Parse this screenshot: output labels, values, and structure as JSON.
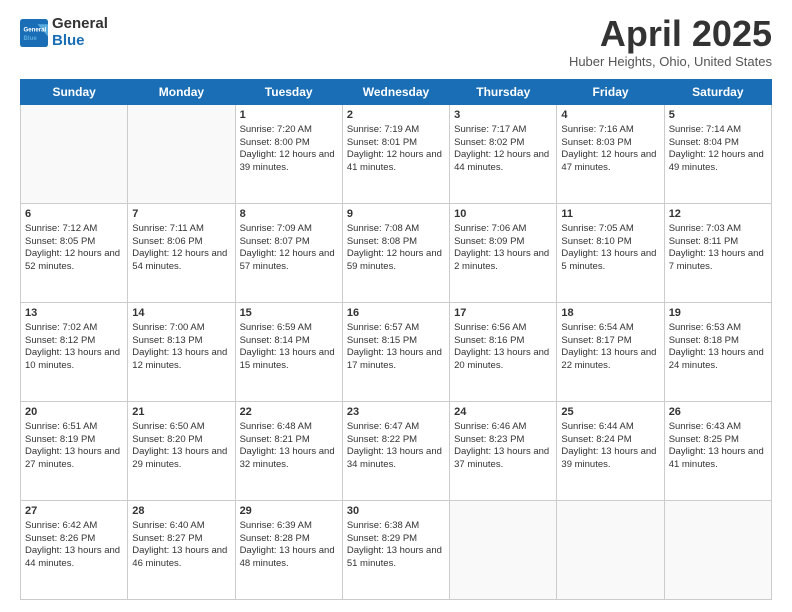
{
  "header": {
    "logo_line1": "General",
    "logo_line2": "Blue",
    "title": "April 2025",
    "location": "Huber Heights, Ohio, United States"
  },
  "weekdays": [
    "Sunday",
    "Monday",
    "Tuesday",
    "Wednesday",
    "Thursday",
    "Friday",
    "Saturday"
  ],
  "weeks": [
    [
      {
        "day": "",
        "content": ""
      },
      {
        "day": "",
        "content": ""
      },
      {
        "day": "1",
        "content": "Sunrise: 7:20 AM\nSunset: 8:00 PM\nDaylight: 12 hours and 39 minutes."
      },
      {
        "day": "2",
        "content": "Sunrise: 7:19 AM\nSunset: 8:01 PM\nDaylight: 12 hours and 41 minutes."
      },
      {
        "day": "3",
        "content": "Sunrise: 7:17 AM\nSunset: 8:02 PM\nDaylight: 12 hours and 44 minutes."
      },
      {
        "day": "4",
        "content": "Sunrise: 7:16 AM\nSunset: 8:03 PM\nDaylight: 12 hours and 47 minutes."
      },
      {
        "day": "5",
        "content": "Sunrise: 7:14 AM\nSunset: 8:04 PM\nDaylight: 12 hours and 49 minutes."
      }
    ],
    [
      {
        "day": "6",
        "content": "Sunrise: 7:12 AM\nSunset: 8:05 PM\nDaylight: 12 hours and 52 minutes."
      },
      {
        "day": "7",
        "content": "Sunrise: 7:11 AM\nSunset: 8:06 PM\nDaylight: 12 hours and 54 minutes."
      },
      {
        "day": "8",
        "content": "Sunrise: 7:09 AM\nSunset: 8:07 PM\nDaylight: 12 hours and 57 minutes."
      },
      {
        "day": "9",
        "content": "Sunrise: 7:08 AM\nSunset: 8:08 PM\nDaylight: 12 hours and 59 minutes."
      },
      {
        "day": "10",
        "content": "Sunrise: 7:06 AM\nSunset: 8:09 PM\nDaylight: 13 hours and 2 minutes."
      },
      {
        "day": "11",
        "content": "Sunrise: 7:05 AM\nSunset: 8:10 PM\nDaylight: 13 hours and 5 minutes."
      },
      {
        "day": "12",
        "content": "Sunrise: 7:03 AM\nSunset: 8:11 PM\nDaylight: 13 hours and 7 minutes."
      }
    ],
    [
      {
        "day": "13",
        "content": "Sunrise: 7:02 AM\nSunset: 8:12 PM\nDaylight: 13 hours and 10 minutes."
      },
      {
        "day": "14",
        "content": "Sunrise: 7:00 AM\nSunset: 8:13 PM\nDaylight: 13 hours and 12 minutes."
      },
      {
        "day": "15",
        "content": "Sunrise: 6:59 AM\nSunset: 8:14 PM\nDaylight: 13 hours and 15 minutes."
      },
      {
        "day": "16",
        "content": "Sunrise: 6:57 AM\nSunset: 8:15 PM\nDaylight: 13 hours and 17 minutes."
      },
      {
        "day": "17",
        "content": "Sunrise: 6:56 AM\nSunset: 8:16 PM\nDaylight: 13 hours and 20 minutes."
      },
      {
        "day": "18",
        "content": "Sunrise: 6:54 AM\nSunset: 8:17 PM\nDaylight: 13 hours and 22 minutes."
      },
      {
        "day": "19",
        "content": "Sunrise: 6:53 AM\nSunset: 8:18 PM\nDaylight: 13 hours and 24 minutes."
      }
    ],
    [
      {
        "day": "20",
        "content": "Sunrise: 6:51 AM\nSunset: 8:19 PM\nDaylight: 13 hours and 27 minutes."
      },
      {
        "day": "21",
        "content": "Sunrise: 6:50 AM\nSunset: 8:20 PM\nDaylight: 13 hours and 29 minutes."
      },
      {
        "day": "22",
        "content": "Sunrise: 6:48 AM\nSunset: 8:21 PM\nDaylight: 13 hours and 32 minutes."
      },
      {
        "day": "23",
        "content": "Sunrise: 6:47 AM\nSunset: 8:22 PM\nDaylight: 13 hours and 34 minutes."
      },
      {
        "day": "24",
        "content": "Sunrise: 6:46 AM\nSunset: 8:23 PM\nDaylight: 13 hours and 37 minutes."
      },
      {
        "day": "25",
        "content": "Sunrise: 6:44 AM\nSunset: 8:24 PM\nDaylight: 13 hours and 39 minutes."
      },
      {
        "day": "26",
        "content": "Sunrise: 6:43 AM\nSunset: 8:25 PM\nDaylight: 13 hours and 41 minutes."
      }
    ],
    [
      {
        "day": "27",
        "content": "Sunrise: 6:42 AM\nSunset: 8:26 PM\nDaylight: 13 hours and 44 minutes."
      },
      {
        "day": "28",
        "content": "Sunrise: 6:40 AM\nSunset: 8:27 PM\nDaylight: 13 hours and 46 minutes."
      },
      {
        "day": "29",
        "content": "Sunrise: 6:39 AM\nSunset: 8:28 PM\nDaylight: 13 hours and 48 minutes."
      },
      {
        "day": "30",
        "content": "Sunrise: 6:38 AM\nSunset: 8:29 PM\nDaylight: 13 hours and 51 minutes."
      },
      {
        "day": "",
        "content": ""
      },
      {
        "day": "",
        "content": ""
      },
      {
        "day": "",
        "content": ""
      }
    ]
  ]
}
